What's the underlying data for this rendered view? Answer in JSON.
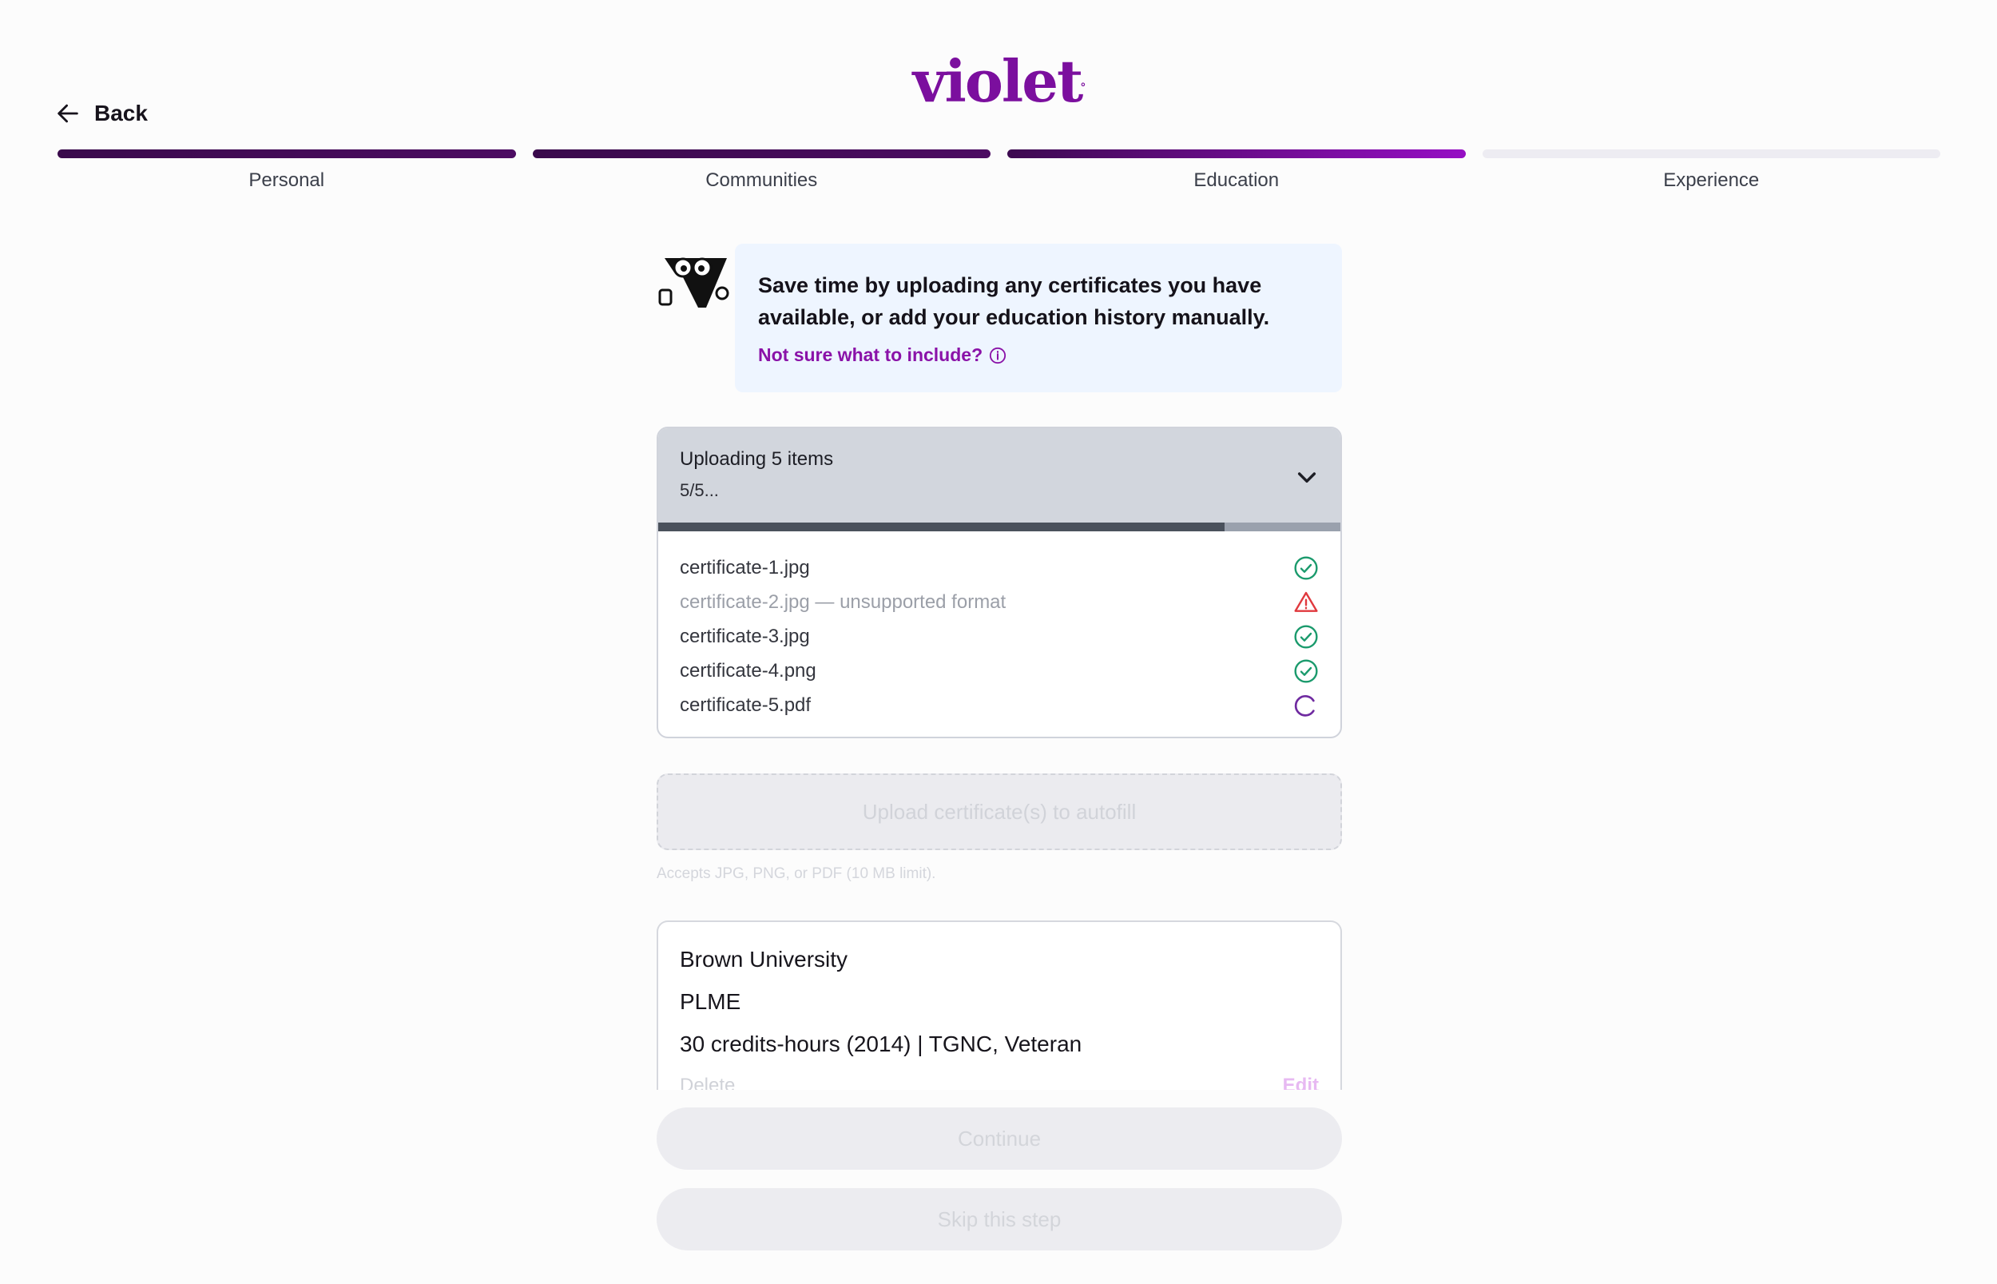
{
  "brand": {
    "name": "violet",
    "mark": "°",
    "color": "#7b0f9e"
  },
  "nav": {
    "back_label": "Back"
  },
  "steps": [
    {
      "label": "Personal",
      "state": "done"
    },
    {
      "label": "Communities",
      "state": "done"
    },
    {
      "label": "Education",
      "state": "active"
    },
    {
      "label": "Experience",
      "state": "pending"
    }
  ],
  "tip": {
    "line1": "Save time by uploading any certificates you have",
    "line2": "available, or add your education history manually.",
    "link": "Not sure what to include?"
  },
  "uploader": {
    "title": "Uploading 5 items",
    "status": "5/5...",
    "progress_fraction": 0.83,
    "files": [
      {
        "name": "certificate-1.jpg",
        "status": "success"
      },
      {
        "name": "certificate-2.jpg — unsupported format",
        "status": "error"
      },
      {
        "name": "certificate-3.jpg",
        "status": "success"
      },
      {
        "name": "certificate-4.png",
        "status": "success"
      },
      {
        "name": "certificate-5.pdf",
        "status": "loading"
      }
    ]
  },
  "upload_button": {
    "label": "Upload certificate(s) to autofill"
  },
  "accepts_note": "Accepts JPG, PNG, or PDF (10 MB limit).",
  "education_card": {
    "school": "Brown University",
    "program": "PLME",
    "details": "30 credits-hours (2014) | TGNC, Veteran",
    "delete_label": "Delete",
    "edit_label": "Edit"
  },
  "buttons": {
    "continue": "Continue",
    "skip": "Skip this step"
  },
  "colors": {
    "success": "#1a9a6c",
    "error": "#e0393e",
    "loading": "#6f2aa0",
    "accent": "#8a12a8"
  }
}
